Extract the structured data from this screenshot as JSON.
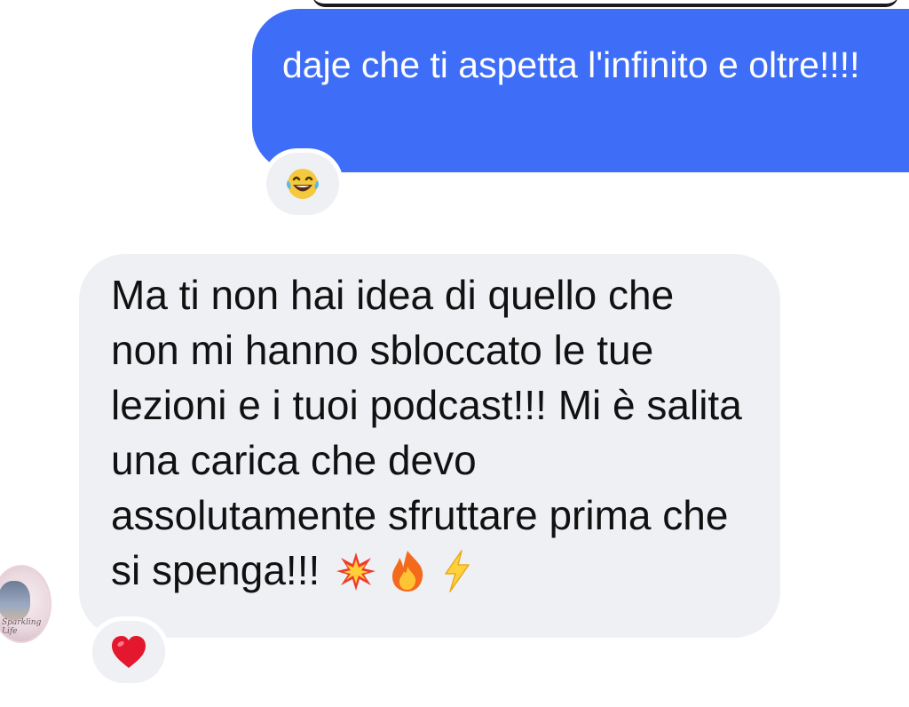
{
  "messages": [
    {
      "direction": "outgoing",
      "text": "daje che ti aspetta l'infinito e oltre!!!!",
      "reaction": {
        "emoji": "😂",
        "icon": "laughing-tears-emoji"
      }
    },
    {
      "direction": "incoming",
      "text": "Ma ti non hai idea di quello che non mi hanno sbloccato le tue lezioni e i tuoi podcast!!! Mi è salita una carica che devo assolutamente sfruttare prima che si spenga!!!",
      "emojis": [
        {
          "char": "💥",
          "icon": "collision-emoji"
        },
        {
          "char": "🔥",
          "icon": "fire-emoji"
        },
        {
          "char": "⚡",
          "icon": "lightning-emoji"
        }
      ],
      "reaction": {
        "emoji": "❤️",
        "icon": "red-heart-emoji"
      }
    }
  ],
  "avatar": {
    "icon": "contact-avatar",
    "caption": "Sparkling Life"
  },
  "colors": {
    "outgoing_bubble": "#3e6ef8",
    "incoming_bubble": "#eff0f4"
  }
}
